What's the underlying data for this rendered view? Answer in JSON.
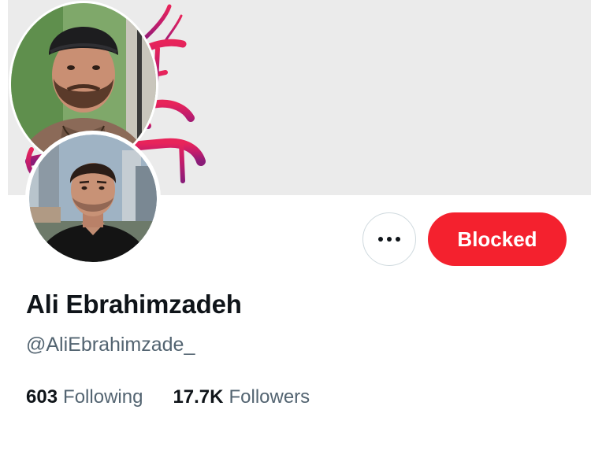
{
  "profile": {
    "display_name": "Ali Ebrahimzadeh",
    "handle": "@AliEbrahimzade_",
    "banner": {
      "background_color": "#ebebeb",
      "calligraphy_colors": [
        "#e8245a",
        "#c21d6c",
        "#8a1c78"
      ],
      "calligraphy_lines": [
        "آزاد باید گردد",
        "همدلانی",
        "شیدا ای"
      ]
    }
  },
  "actions": {
    "more_icon": "ellipsis-icon",
    "blocked_label": "Blocked",
    "blocked_color": "#f4212e"
  },
  "stats": {
    "following_count": "603",
    "following_label": "Following",
    "followers_count": "17.7K",
    "followers_label": "Followers"
  }
}
